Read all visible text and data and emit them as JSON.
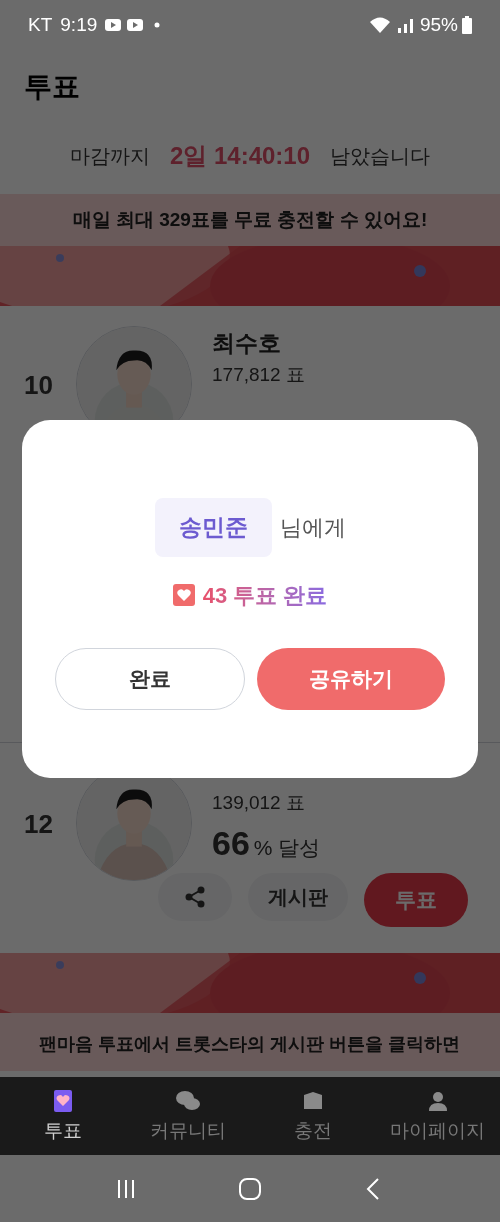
{
  "status_bar": {
    "carrier": "KT",
    "time": "9:19",
    "battery": "95%"
  },
  "header": {
    "title": "투표"
  },
  "countdown": {
    "prefix": "마감까지",
    "remaining": "2일 14:40:10",
    "suffix": "남았습니다"
  },
  "top_banner": {
    "text": "매일 최대 329표를 무료 충전할 수 있어요!"
  },
  "candidates": [
    {
      "rank": "10",
      "name": "최수호",
      "votes": "177,812 표"
    },
    {
      "rank": "12",
      "votes": "139,012 표",
      "percent": "66",
      "percent_label": "% 달성",
      "board_button": "게시판",
      "vote_button": "투표"
    }
  ],
  "bottom_banner": {
    "text": "팬마음 투표에서 트롯스타의 게시판 버튼을 클릭하면"
  },
  "nav_tabs": [
    {
      "label": "투표",
      "selected": true
    },
    {
      "label": "커뮤니티",
      "selected": false
    },
    {
      "label": "충전",
      "selected": false
    },
    {
      "label": "마이페이지",
      "selected": false
    }
  ],
  "dialog": {
    "recipient": "송민준",
    "recipient_suffix": "님에게",
    "result": "43 투표 완료",
    "buttons": [
      {
        "label": "완료",
        "kind": "secondary"
      },
      {
        "label": "공유하기",
        "kind": "primary"
      }
    ]
  }
}
